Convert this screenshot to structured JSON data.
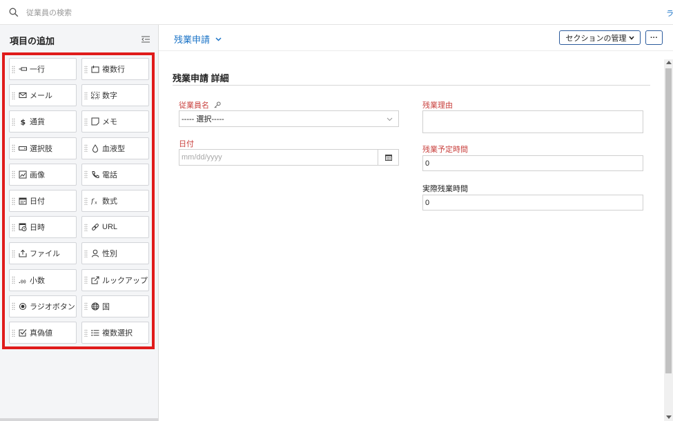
{
  "search": {
    "placeholder": "従業員の検索",
    "right_link": "ラ"
  },
  "left_panel": {
    "title": "項目の追加",
    "fields": [
      {
        "label": "一行",
        "icon": "single-line-icon"
      },
      {
        "label": "複数行",
        "icon": "multi-line-icon"
      },
      {
        "label": "メール",
        "icon": "mail-icon"
      },
      {
        "label": "数字",
        "icon": "number-icon"
      },
      {
        "label": "通貨",
        "icon": "currency-icon"
      },
      {
        "label": "メモ",
        "icon": "memo-icon"
      },
      {
        "label": "選択肢",
        "icon": "dropdown-icon"
      },
      {
        "label": "血液型",
        "icon": "blood-drop-icon"
      },
      {
        "label": "画像",
        "icon": "image-icon"
      },
      {
        "label": "電話",
        "icon": "phone-icon"
      },
      {
        "label": "日付",
        "icon": "calendar-icon"
      },
      {
        "label": "数式",
        "icon": "formula-icon"
      },
      {
        "label": "日時",
        "icon": "datetime-icon"
      },
      {
        "label": "URL",
        "icon": "link-icon"
      },
      {
        "label": "ファイル",
        "icon": "upload-icon"
      },
      {
        "label": "性別",
        "icon": "person-icon"
      },
      {
        "label": "小数",
        "icon": "decimal-icon"
      },
      {
        "label": "ルックアップ",
        "icon": "lookup-icon"
      },
      {
        "label": "ラジオボタン",
        "icon": "radio-icon"
      },
      {
        "label": "国",
        "icon": "globe-icon"
      },
      {
        "label": "真偽値",
        "icon": "checkbox-icon"
      },
      {
        "label": "複数選択",
        "icon": "multi-select-icon"
      }
    ]
  },
  "toolbar": {
    "form_name": "残業申請",
    "section_manage": "セクションの管理",
    "more": "···"
  },
  "section": {
    "title": "残業申請 詳細",
    "employee_name_label": "従業員名",
    "employee_select_value": "----- 選択-----",
    "date_label": "日付",
    "date_placeholder": "mm/dd/yyyy",
    "reason_label": "残業理由",
    "planned_hours_label": "残業予定時間",
    "planned_hours_value": "0",
    "actual_hours_label": "実際残業時間",
    "actual_hours_value": "0"
  },
  "colors": {
    "accent": "#1a73c7",
    "required": "#c9413e",
    "highlight_border": "#e01b1b"
  }
}
